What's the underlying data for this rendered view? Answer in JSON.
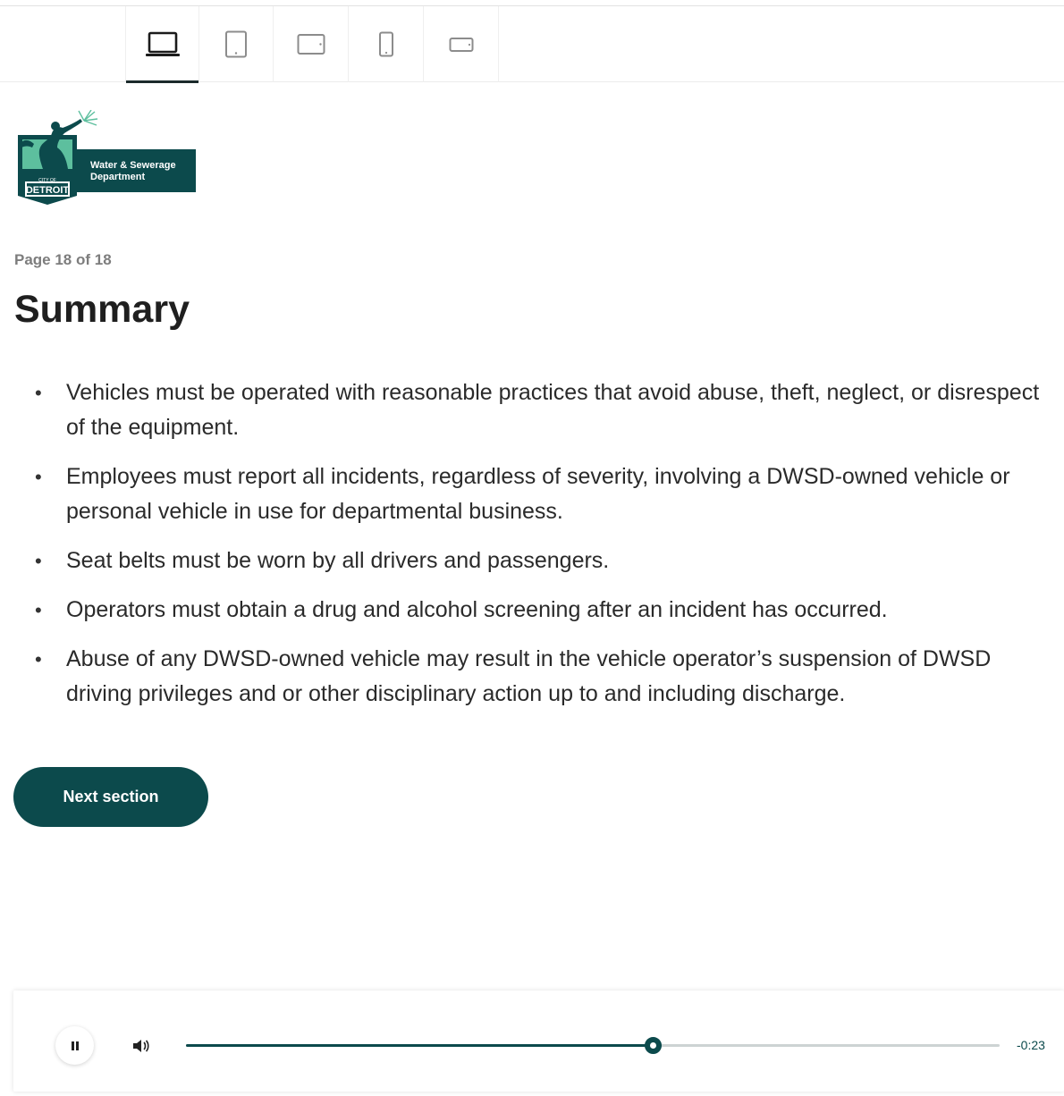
{
  "device_toolbar": {
    "devices": [
      {
        "icon": "laptop-icon",
        "active": true
      },
      {
        "icon": "tablet-portrait-icon",
        "active": false
      },
      {
        "icon": "tablet-landscape-icon",
        "active": false
      },
      {
        "icon": "phone-portrait-icon",
        "active": false
      },
      {
        "icon": "phone-landscape-icon",
        "active": false
      }
    ]
  },
  "logo": {
    "department": "Water & Sewerage\nDepartment",
    "city_small": "CITY OF",
    "city": "DETROIT",
    "brand_color": "#0c4a4c",
    "accent_color": "#5dbf9e"
  },
  "page": {
    "indicator": "Page 18 of 18",
    "title": "Summary"
  },
  "summary": {
    "items": [
      "Vehicles must be operated with reasonable practices that avoid abuse, theft, neglect, or disrespect of the equipment.",
      "Employees must report all incidents, regardless of severity, involving a DWSD-owned vehicle or personal vehicle in use for departmental business.",
      "Seat belts must be worn by all drivers and passengers.",
      "Operators must obtain a drug and alcohol screening after an incident has occurred.",
      "Abuse of any DWSD-owned vehicle may result in the vehicle operator’s suspension of DWSD driving privileges and or other disciplinary action up to and including discharge."
    ]
  },
  "next_button": {
    "label": "Next section"
  },
  "audio": {
    "state": "playing",
    "progress_percent": 57.5,
    "time_remaining": "-0:23",
    "accent_color": "#0c4a4c"
  }
}
